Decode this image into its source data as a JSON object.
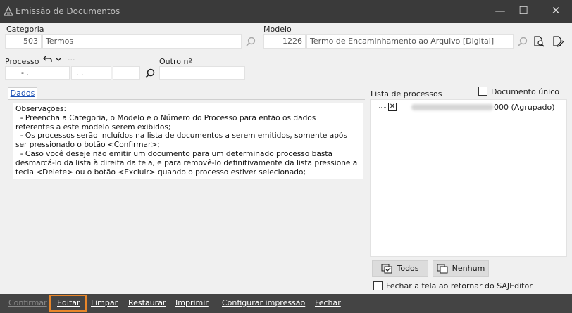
{
  "window": {
    "title": "Emissão de Documentos",
    "minimize": "—",
    "maximize": "☐",
    "close": "✕"
  },
  "categoria": {
    "label": "Categoria",
    "code": "503",
    "name": "Termos"
  },
  "modelo": {
    "label": "Modelo",
    "code": "1226",
    "name": "Termo de Encaminhamento ao Arquivo [Digital]"
  },
  "processo": {
    "label": "Processo",
    "ellipsis": "···",
    "part1": "-  .",
    "part2": ".  .",
    "part3": ""
  },
  "outro": {
    "label": "Outro nº",
    "value": ""
  },
  "tabs": {
    "dados": "Dados"
  },
  "observacoes": {
    "lines": [
      "Observações:",
      "  - Preencha a Categoria, o Modelo e o Número do Processo para então os dados",
      "referentes a este modelo serem exibidos;",
      "  - Os processos serão incluídos na lista de documentos a serem emitidos, somente após",
      "ser pressionado o botão <Confirmar>;",
      "  - Caso você deseje não emitir um documento para um determinado processo basta",
      "desmarcá-lo da lista à direita da tela, e para removê-lo definitivamente da lista pressione a",
      "tecla <Delete> ou o botão <Excluir> quando o processo estiver selecionado;"
    ]
  },
  "documento_unico": {
    "label": "Documento único",
    "checked": false
  },
  "lista_processos": {
    "label": "Lista de processos",
    "items": [
      {
        "check": "✕",
        "suffix": "000 (Agrupado)",
        "checked": true
      }
    ]
  },
  "buttons": {
    "todos": "Todos",
    "nenhum": "Nenhum"
  },
  "fechar_tela": {
    "label": "Fechar a tela ao retornar do SAJEditor",
    "checked": false
  },
  "footer": {
    "confirmar": "Confirmar",
    "editar": "Editar",
    "limpar": "Limpar",
    "restaurar": "Restaurar",
    "imprimir": "Imprimir",
    "configurar": "Configurar impressão",
    "fechar": "Fechar"
  },
  "colors": {
    "titlebar": "#3a3a3a",
    "footer": "#444444",
    "focus": "#e8862a",
    "tab_text": "#1a4fb5"
  },
  "icons": [
    "app-icon",
    "search-icon",
    "doc-search-icon",
    "doc-edit-icon",
    "undo-icon",
    "chevron-down-icon",
    "check-list-icon",
    "uncheck-list-icon"
  ]
}
